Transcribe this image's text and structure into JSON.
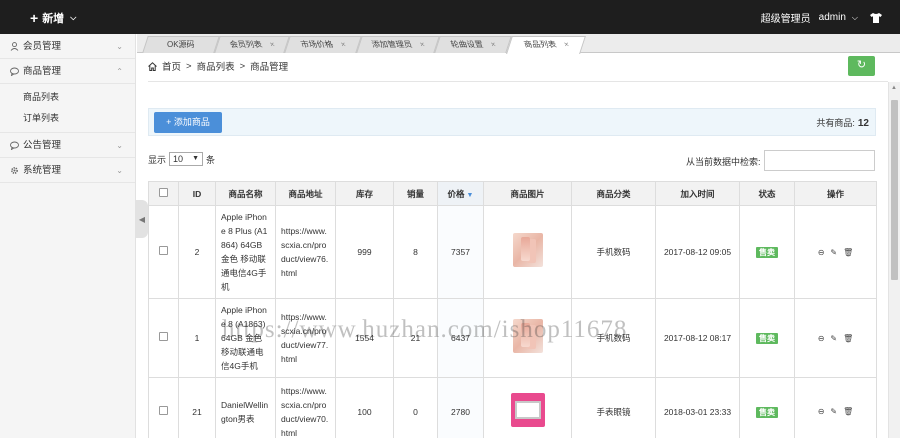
{
  "topbar": {
    "new_label": "新增",
    "role": "超级管理员",
    "username": "admin"
  },
  "sidebar": {
    "groups": [
      {
        "label": "会员管理",
        "icon": "user-icon",
        "expanded": false
      },
      {
        "label": "商品管理",
        "icon": "chat-icon",
        "expanded": true,
        "items": [
          "商品列表",
          "订单列表"
        ]
      },
      {
        "label": "公告管理",
        "icon": "chat-icon",
        "expanded": false
      },
      {
        "label": "系统管理",
        "icon": "gear-icon",
        "expanded": false
      }
    ]
  },
  "tabs": [
    {
      "label": "OK源码",
      "closable": false
    },
    {
      "label": "会员列表",
      "closable": true
    },
    {
      "label": "市场价格",
      "closable": true
    },
    {
      "label": "添加管理员",
      "closable": true
    },
    {
      "label": "轮曲设置",
      "closable": true
    },
    {
      "label": "商品列表",
      "closable": true,
      "active": true
    }
  ],
  "breadcrumb": [
    "首页",
    "商品列表",
    "商品管理"
  ],
  "toolbar": {
    "add_label": "添加商品",
    "count_label": "共有商品:",
    "count_value": "12"
  },
  "table_controls": {
    "show_label": "显示",
    "page_size": "10",
    "unit_label": "条",
    "search_label": "从当前数据中检索:",
    "search_value": ""
  },
  "table": {
    "columns": [
      "ID",
      "商品名称",
      "商品地址",
      "库存",
      "销量",
      "价格",
      "商品图片",
      "商品分类",
      "加入时间",
      "状态",
      "操作"
    ],
    "rows": [
      {
        "id": "2",
        "name": "Apple iPhone 8 Plus (A1864) 64GB 金色 移动联通电信4G手机",
        "url": "https://www.scxia.cn/product/view76.html",
        "stock": "999",
        "sales": "8",
        "price": "7357",
        "image": "iphone-8-plus-photo",
        "category": "手机数码",
        "added": "2017-08-12 09:05",
        "status": "售卖"
      },
      {
        "id": "1",
        "name": "Apple iPhone 8 (A1863) 64GB 金色 移动联通电信4G手机",
        "url": "https://www.scxia.cn/product/view77.html",
        "stock": "1554",
        "sales": "21",
        "price": "6437",
        "image": "iphone-8-photo",
        "category": "手机数码",
        "added": "2017-08-12 08:17",
        "status": "售卖"
      },
      {
        "id": "21",
        "name": "DanielWellington男表",
        "url": "https://www.scxia.cn/product/view70.html",
        "stock": "100",
        "sales": "0",
        "price": "2780",
        "image": "watch-photo",
        "category": "手表眼镜",
        "added": "2018-03-01 23:33",
        "status": "售卖"
      }
    ]
  },
  "watermark": "https://www.huzhan.com/ishop11678",
  "colors": {
    "topbar": "#1e1e1e",
    "accent_blue": "#4b8fd9",
    "success_green": "#5eb95e",
    "panel_bg": "#eef6fb"
  }
}
